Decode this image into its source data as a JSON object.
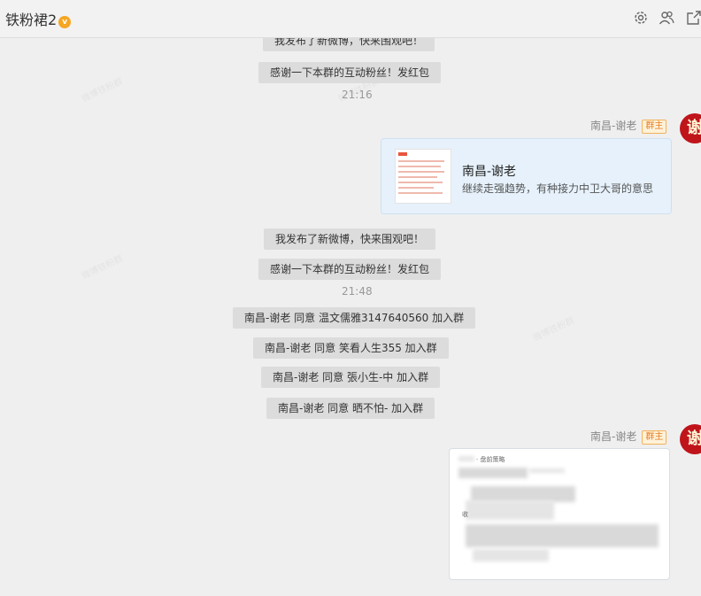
{
  "header": {
    "title": "铁粉裙2",
    "vip_badge": "v",
    "icons": [
      "settings-icon",
      "members-icon",
      "share-out-icon"
    ]
  },
  "messages": {
    "sys1": "我发布了新微博，快来围观吧！",
    "sys2": "感谢一下本群的互动粉丝！发红包",
    "time1": "21:16",
    "sender_name": "南昌-谢老",
    "sender_badge": "群主",
    "avatar_char": "谢",
    "card_title": "南昌-谢老",
    "card_desc": "继续走强趋势，有种接力中卫大哥的意思",
    "sys3": "我发布了新微博，快来围观吧！",
    "sys4": "感谢一下本群的互动粉丝！发红包",
    "time2": "21:48",
    "join1": "南昌-谢老 同意 温文儒雅3147640560 加入群",
    "join2": "南昌-谢老 同意 笑看人生355 加入群",
    "join3": "南昌-谢老 同意 張小生-中 加入群",
    "join4": "南昌-谢老 同意 晒不怕- 加入群",
    "sender_name2": "南昌-谢老",
    "sender_badge2": "群主",
    "avatar_char2": "谢",
    "img_caption": "· 盘前策略",
    "img_line": "收"
  },
  "colors": {
    "accent_badge": "#e67e22",
    "card_bg": "#e6f1fb",
    "avatar": "#c0141b"
  }
}
